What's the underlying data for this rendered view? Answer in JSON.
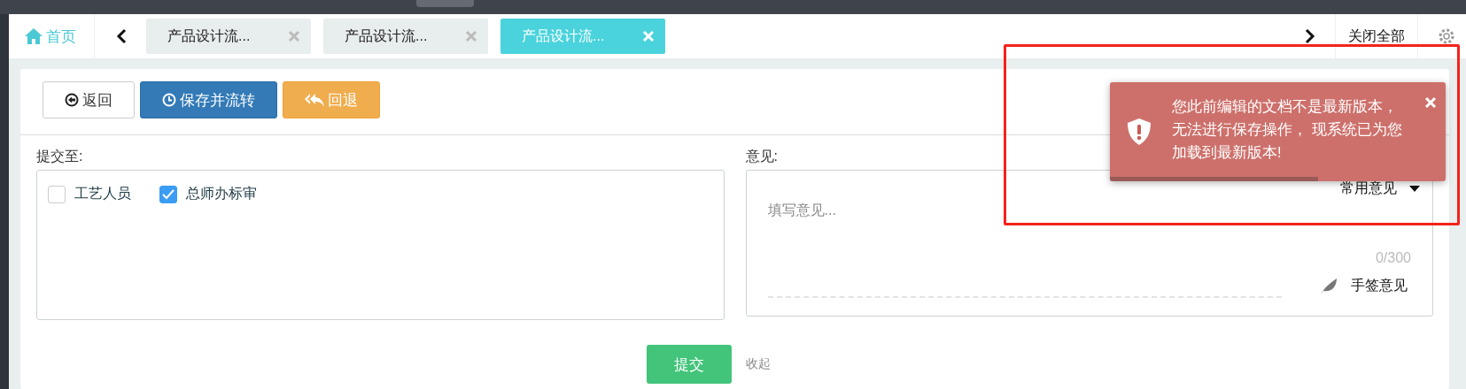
{
  "header": {
    "home": "首页",
    "close_all": "关闭全部"
  },
  "tabs": [
    {
      "label": "产品设计流...",
      "selected": false
    },
    {
      "label": "产品设计流...",
      "selected": false
    },
    {
      "label": "产品设计流...",
      "selected": true
    }
  ],
  "toolbar": {
    "buttons": [
      {
        "label": "返回",
        "kind": "default"
      },
      {
        "label": "保存并流转",
        "kind": "primary"
      },
      {
        "label": "回退",
        "kind": "warning"
      }
    ]
  },
  "submit_to": {
    "label": "提交至:",
    "options": [
      {
        "label": "工艺人员",
        "checked": false
      },
      {
        "label": "总师办标审",
        "checked": true
      }
    ]
  },
  "opinion": {
    "label": "意见:",
    "preset": "常用意见",
    "placeholder": "填写意见...",
    "counter": "0/300",
    "signature": "手签意见"
  },
  "actions": {
    "submit": "提交",
    "collapse": "收起"
  },
  "toast": {
    "message": "您此前编辑的文档不是最新版本，无法进行保存操作， 现系统已为您加载到最新版本!",
    "level": 0.62
  }
}
